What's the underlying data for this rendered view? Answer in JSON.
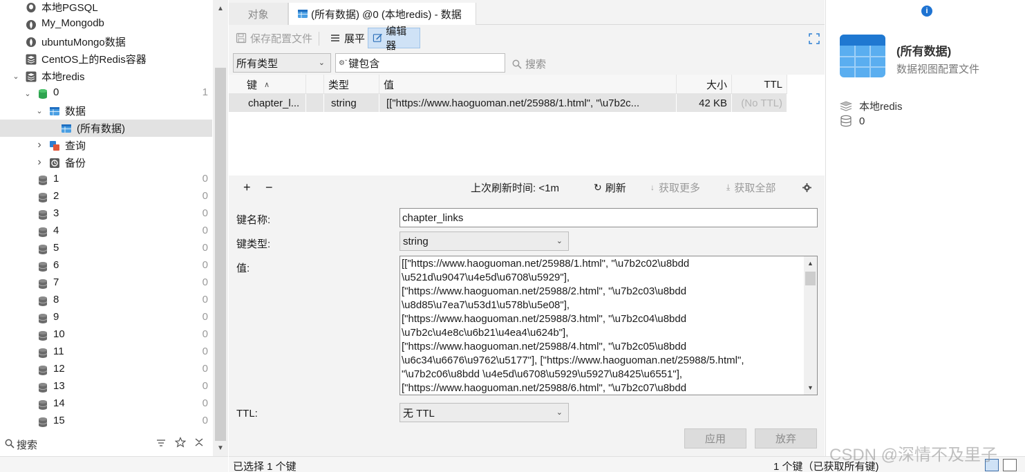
{
  "tree": {
    "items": [
      {
        "label": "本地PGSQL",
        "icon": "postgresql-icon",
        "count": ""
      },
      {
        "label": "My_Mongodb",
        "icon": "mongodb-leaf-icon",
        "count": ""
      },
      {
        "label": "ubuntuMongo数据",
        "icon": "mongodb-leaf-icon",
        "count": ""
      },
      {
        "label": "CentOS上的Redis容器",
        "icon": "redis-stack-icon",
        "count": ""
      },
      {
        "label": "本地redis",
        "icon": "redis-stack-icon",
        "count": ""
      },
      {
        "label": "0",
        "icon": "database-green-icon",
        "count": "1"
      },
      {
        "label": "数据",
        "icon": "table-icon",
        "count": ""
      },
      {
        "label": "(所有数据)",
        "icon": "table-icon",
        "count": ""
      },
      {
        "label": "查询",
        "icon": "query-icon",
        "count": ""
      },
      {
        "label": "备份",
        "icon": "backup-icon",
        "count": ""
      },
      {
        "label": "1",
        "icon": "database-grey-icon",
        "count": "0"
      },
      {
        "label": "2",
        "icon": "database-grey-icon",
        "count": "0"
      },
      {
        "label": "3",
        "icon": "database-grey-icon",
        "count": "0"
      },
      {
        "label": "4",
        "icon": "database-grey-icon",
        "count": "0"
      },
      {
        "label": "5",
        "icon": "database-grey-icon",
        "count": "0"
      },
      {
        "label": "6",
        "icon": "database-grey-icon",
        "count": "0"
      },
      {
        "label": "7",
        "icon": "database-grey-icon",
        "count": "0"
      },
      {
        "label": "8",
        "icon": "database-grey-icon",
        "count": "0"
      },
      {
        "label": "9",
        "icon": "database-grey-icon",
        "count": "0"
      },
      {
        "label": "10",
        "icon": "database-grey-icon",
        "count": "0"
      },
      {
        "label": "11",
        "icon": "database-grey-icon",
        "count": "0"
      },
      {
        "label": "12",
        "icon": "database-grey-icon",
        "count": "0"
      },
      {
        "label": "13",
        "icon": "database-grey-icon",
        "count": "0"
      },
      {
        "label": "14",
        "icon": "database-grey-icon",
        "count": "0"
      },
      {
        "label": "15",
        "icon": "database-grey-icon",
        "count": "0"
      }
    ],
    "search_label": "搜索"
  },
  "tabs": {
    "objects": "对象",
    "data": "(所有数据) @0 (本地redis) - 数据"
  },
  "toolbar": {
    "save_profile": "保存配置文件",
    "flatten": "展平",
    "editor": "编辑器"
  },
  "filter": {
    "type_selected": "所有类型",
    "key_contains": "键包含",
    "search": "搜索"
  },
  "grid": {
    "headers": {
      "key": "键",
      "type": "类型",
      "value": "值",
      "size": "大小",
      "ttl": "TTL"
    },
    "rows": [
      {
        "key": "chapter_l...",
        "type": "string",
        "value": "[[\"https://www.haoguoman.net/25988/1.html\", \"\\u7b2c...",
        "size": "42 KB",
        "ttl": "(No TTL)"
      }
    ]
  },
  "grid_footer": {
    "add": "+",
    "remove": "−",
    "last_refresh": "上次刷新时间: <1m",
    "refresh": "刷新",
    "fetch_more": "获取更多",
    "fetch_all": "获取全部"
  },
  "form": {
    "key_name_label": "键名称:",
    "key_name_value": "chapter_links",
    "key_type_label": "键类型:",
    "key_type_value": "string",
    "value_label": "值:",
    "value_lines": [
      "[[\"https://www.haoguoman.net/25988/1.html\", \"\\u7b2c02\\u8bdd",
      "\\u521d\\u9047\\u4e5d\\u6708\\u5929\"],",
      "[\"https://www.haoguoman.net/25988/2.html\", \"\\u7b2c03\\u8bdd",
      "\\u8d85\\u7ea7\\u53d1\\u578b\\u5e08\"],",
      "[\"https://www.haoguoman.net/25988/3.html\", \"\\u7b2c04\\u8bdd",
      "\\u7b2c\\u4e8c\\u6b21\\u4ea4\\u624b\"],",
      "[\"https://www.haoguoman.net/25988/4.html\", \"\\u7b2c05\\u8bdd",
      "\\u6c34\\u6676\\u9762\\u5177\"], [\"https://www.haoguoman.net/25988/5.html\",",
      "\"\\u7b2c06\\u8bdd \\u4e5d\\u6708\\u5929\\u5927\\u8425\\u6551\"],",
      "[\"https://www.haoguoman.net/25988/6.html\", \"\\u7b2c07\\u8bdd"
    ],
    "ttl_label": "TTL:",
    "ttl_value": "无 TTL",
    "apply": "应用",
    "discard": "放弃"
  },
  "status": {
    "selected": "已选择 1 个键",
    "total": "1 个键（已获取所有键)"
  },
  "info_panel": {
    "title": "(所有数据)",
    "subtitle": "数据视图配置文件",
    "connection": "本地redis",
    "database": "0"
  },
  "watermark": "CSDN @深情不及里子",
  "colors": {
    "selection_grey": "#e2e2e2",
    "accent_blue": "#1e73d2",
    "pressed_button": "#cfe2f6",
    "redis_red": "#d9534f",
    "db_green": "#2ea44f"
  }
}
